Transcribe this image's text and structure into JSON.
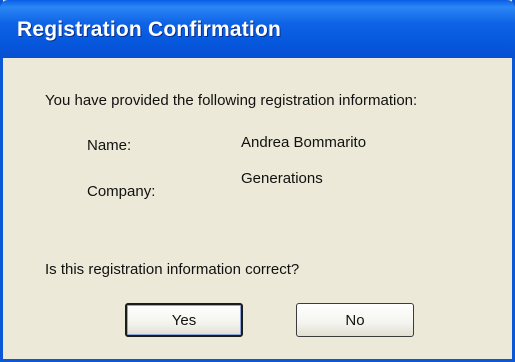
{
  "window": {
    "title": "Registration Confirmation"
  },
  "content": {
    "intro": "You have provided the following registration information:",
    "fields": [
      {
        "label": "Name:",
        "value": "Andrea Bommarito"
      },
      {
        "label": "Company:",
        "value": "Generations"
      }
    ],
    "question": "Is this registration information correct?"
  },
  "buttons": {
    "yes": "Yes",
    "no": "No"
  },
  "colors": {
    "titlebar": "#0a5ee8",
    "dialog_background": "#ece9d8"
  }
}
